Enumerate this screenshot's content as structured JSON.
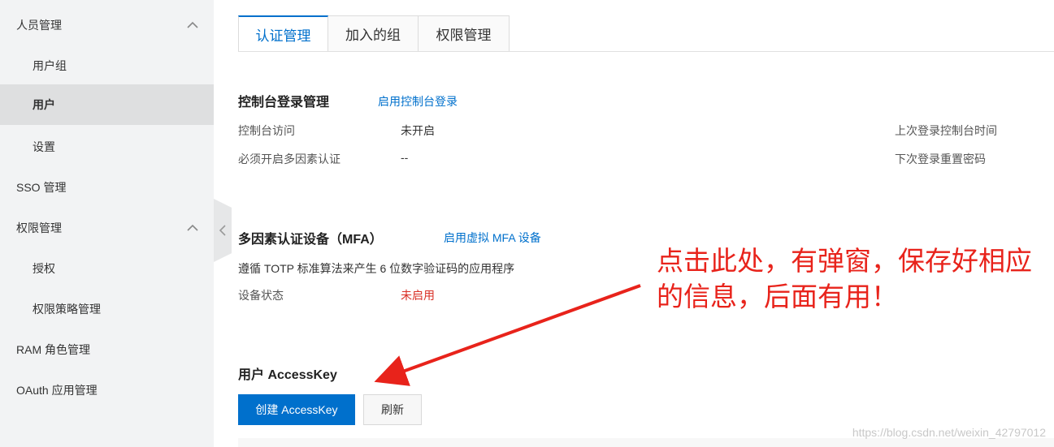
{
  "sidebar": {
    "items": [
      {
        "label": "人员管理",
        "expanded": true
      },
      {
        "label": "用户组"
      },
      {
        "label": "用户",
        "active": true
      },
      {
        "label": "设置"
      },
      {
        "label": "SSO 管理"
      },
      {
        "label": "权限管理",
        "expanded": true
      },
      {
        "label": "授权"
      },
      {
        "label": "权限策略管理"
      },
      {
        "label": "RAM 角色管理"
      },
      {
        "label": "OAuth 应用管理"
      }
    ]
  },
  "tabs": [
    {
      "label": "认证管理",
      "active": true
    },
    {
      "label": "加入的组"
    },
    {
      "label": "权限管理"
    }
  ],
  "console_login": {
    "title": "控制台登录管理",
    "action_link": "启用控制台登录",
    "access_label": "控制台访问",
    "access_value": "未开启",
    "mfa_required_label": "必须开启多因素认证",
    "mfa_required_value": "--",
    "last_login_label": "上次登录控制台时间",
    "next_reset_label": "下次登录重置密码"
  },
  "mfa": {
    "title": "多因素认证设备（MFA）",
    "action_link": "启用虚拟 MFA 设备",
    "description": "遵循 TOTP 标准算法来产生 6 位数字验证码的应用程序",
    "status_label": "设备状态",
    "status_value": "未启用"
  },
  "accesskey": {
    "title": "用户 AccessKey",
    "create_button": "创建 AccessKey",
    "refresh_button": "刷新"
  },
  "annotation": {
    "text": "点击此处，有弹窗，保存好相应的信息，后面有用！",
    "color": "#e8231b"
  },
  "watermark": "https://blog.csdn.net/weixin_42797012",
  "colors": {
    "accent": "#0070cc",
    "danger": "#d93026",
    "sidebar_bg": "#f2f3f4"
  }
}
